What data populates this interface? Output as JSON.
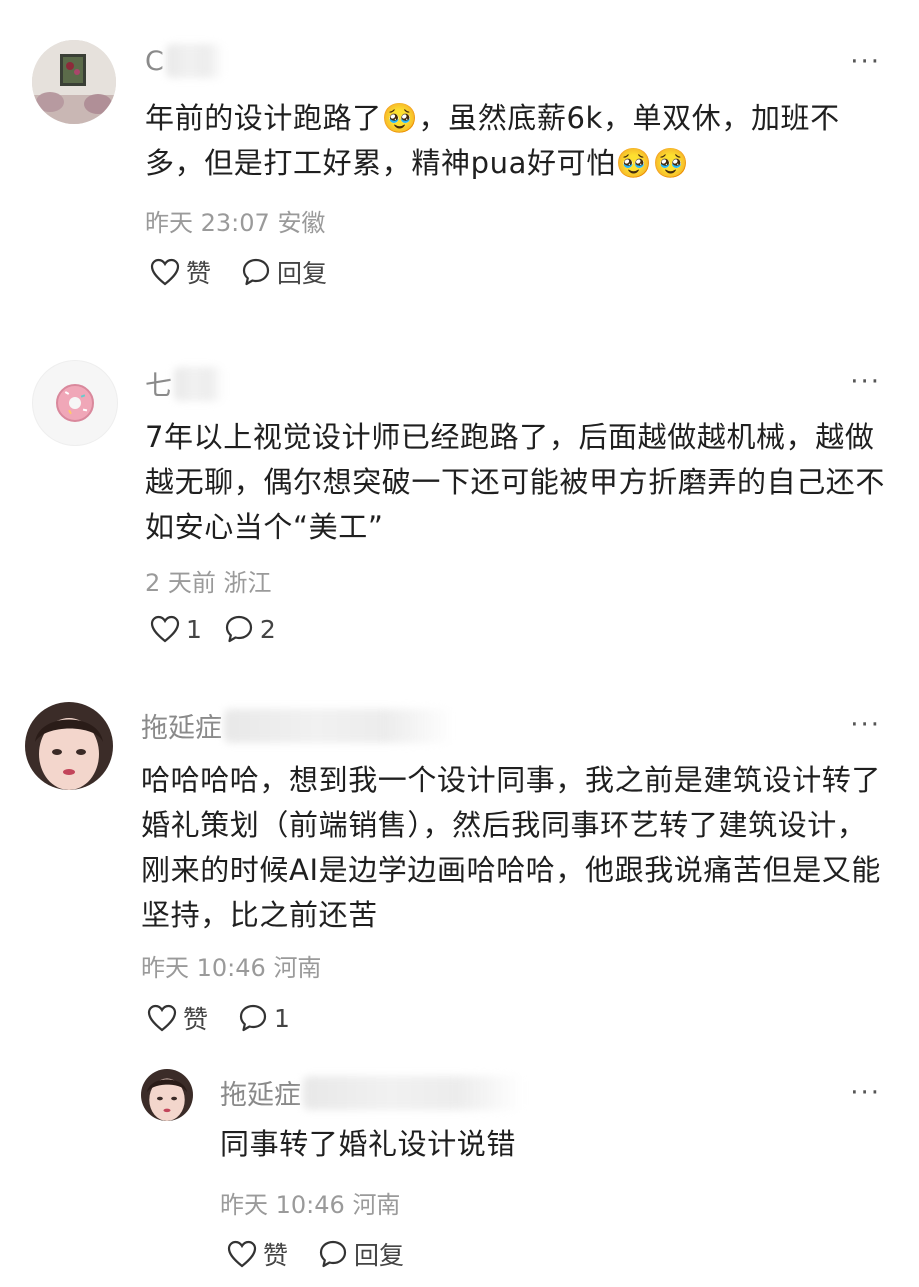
{
  "comments": [
    {
      "name": "C",
      "text": "年前的设计跑路了🥹，虽然底薪6k，单双休，加班不多，但是打工好累，精神pua好可怕🥹🥹",
      "time": "昨天 23:07",
      "location": "安徽",
      "like_label": "赞",
      "reply_label": "回复",
      "avatar_icon": "painting-room-photo"
    },
    {
      "name": "七",
      "text": "7年以上视觉设计师已经跑路了，后面越做越机械，越做越无聊，偶尔想突破一下还可能被甲方折磨弄的自己还不如安心当个“美工”",
      "time": "2 天前",
      "location": "浙江",
      "like_label": "1",
      "reply_label": "2",
      "avatar_icon": "donut-icon"
    },
    {
      "name": "拖延症",
      "text": "哈哈哈哈，想到我一个设计同事，我之前是建筑设计转了婚礼策划（前端销售），然后我同事环艺转了建筑设计，刚来的时候AI是边学边画哈哈哈，他跟我说痛苦但是又能坚持，比之前还苦",
      "time": "昨天 10:46",
      "location": "河南",
      "like_label": "赞",
      "reply_label": "1",
      "avatar_icon": "girl-face-photo"
    }
  ],
  "reply": {
    "name": "拖延症",
    "text": "同事转了婚礼设计说错",
    "time": "昨天 10:46",
    "location": "河南",
    "like_label": "赞",
    "reply_label": "回复",
    "avatar_icon": "girl-face-photo"
  },
  "more_label": "···"
}
